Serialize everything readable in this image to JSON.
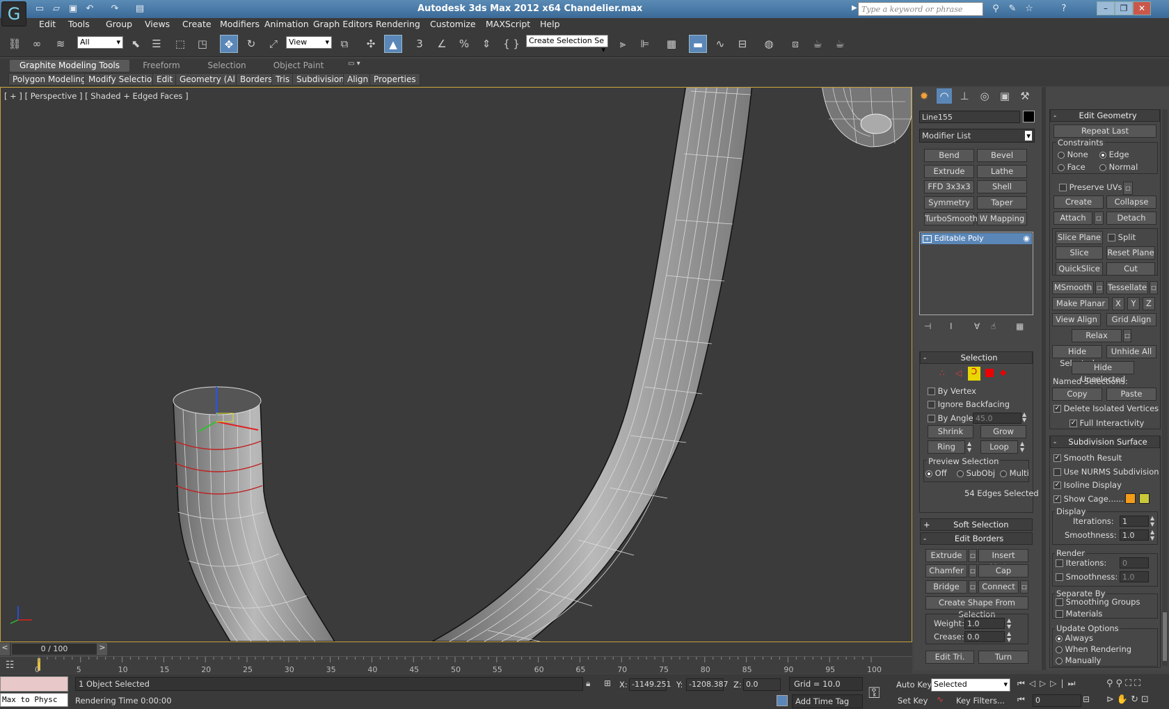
{
  "window": {
    "title": "Autodesk 3ds Max  2012 x64      Chandelier.max",
    "search_placeholder": "Type a keyword or phrase"
  },
  "menu": [
    "Edit",
    "Tools",
    "Group",
    "Views",
    "Create",
    "Modifiers",
    "Animation",
    "Graph Editors",
    "Rendering",
    "Customize",
    "MAXScript",
    "Help"
  ],
  "toolbar": {
    "filter": "All",
    "ref_coord": "View",
    "selection_set": "Create Selection Se"
  },
  "ribbon": {
    "tabs": [
      "Graphite Modeling Tools",
      "Freeform",
      "Selection",
      "Object Paint"
    ],
    "subtabs": [
      "Polygon Modeling",
      "Modify Selection",
      "Edit",
      "Geometry (All)",
      "Borders",
      "Tris",
      "Subdivision",
      "Align",
      "Properties"
    ]
  },
  "viewport": {
    "label": "[ + ] [ Perspective ] [ Shaded + Edged Faces ]"
  },
  "panel": {
    "object_name": "Line155",
    "modifier_list": "Modifier List",
    "modifier_buttons": [
      "Bend",
      "Bevel",
      "Extrude",
      "Lathe",
      "FFD 3x3x3",
      "Shell",
      "Symmetry",
      "Taper",
      "TurboSmooth",
      "W Mapping Cle"
    ],
    "stack_item": "Editable Poly",
    "selection": {
      "title": "Selection",
      "by_vertex": "By Vertex",
      "ignore_backfacing": "Ignore Backfacing",
      "by_angle": "By Angle:",
      "angle": "45.0",
      "shrink": "Shrink",
      "grow": "Grow",
      "ring": "Ring",
      "loop": "Loop",
      "preview": "Preview Selection",
      "off": "Off",
      "subobj": "SubObj",
      "multi": "Multi",
      "status": "54 Edges Selected"
    },
    "soft_selection": "Soft Selection",
    "edit_borders": {
      "title": "Edit Borders",
      "extrude": "Extrude",
      "insert_vertex": "Insert Vertex",
      "chamfer": "Chamfer",
      "cap": "Cap",
      "bridge": "Bridge",
      "connect": "Connect",
      "create_shape": "Create Shape From Selection",
      "weight_label": "Weight:",
      "weight": "1.0",
      "crease_label": "Crease:",
      "crease": "0.0",
      "edit_tri": "Edit Tri.",
      "turn": "Turn"
    },
    "edit_geometry": {
      "title": "Edit Geometry",
      "repeat_last": "Repeat Last",
      "constraints": "Constraints",
      "none": "None",
      "edge": "Edge",
      "face": "Face",
      "normal": "Normal",
      "preserve_uvs": "Preserve UVs",
      "create": "Create",
      "collapse": "Collapse",
      "attach": "Attach",
      "detach": "Detach",
      "slice_plane": "Slice Plane",
      "split": "Split",
      "slice": "Slice",
      "reset_plane": "Reset Plane",
      "quickslice": "QuickSlice",
      "cut": "Cut",
      "msmooth": "MSmooth",
      "tessellate": "Tessellate",
      "make_planar": "Make Planar",
      "x": "X",
      "y": "Y",
      "z": "Z",
      "view_align": "View Align",
      "grid_align": "Grid Align",
      "relax": "Relax",
      "hide_selected": "Hide Selected",
      "unhide_all": "Unhide All",
      "hide_unselected": "Hide Unselected",
      "named_selections": "Named Selections:",
      "copy": "Copy",
      "paste": "Paste",
      "delete_isolated": "Delete Isolated Vertices",
      "full_interactivity": "Full Interactivity"
    },
    "subdivision": {
      "title": "Subdivision Surface",
      "smooth_result": "Smooth Result",
      "use_nurms": "Use NURMS Subdivision",
      "isoline": "Isoline Display",
      "show_cage": "Show Cage......",
      "display": "Display",
      "iterations_label": "Iterations:",
      "iterations": "1",
      "smoothness_label": "Smoothness:",
      "smoothness": "1.0",
      "render": "Render",
      "r_iterations": "0",
      "r_smoothness": "1.0",
      "separate_by": "Separate By",
      "smoothing_groups": "Smoothing Groups",
      "materials": "Materials",
      "update_options": "Update Options",
      "always": "Always",
      "when_rendering": "When Rendering",
      "manually": "Manually",
      "cage_color1": "#f39c1a",
      "cage_color2": "#c8c83a"
    }
  },
  "timeline": {
    "position": "0 / 100",
    "ticks": [
      "0",
      "5",
      "10",
      "15",
      "20",
      "25",
      "30",
      "35",
      "40",
      "45",
      "50",
      "55",
      "60",
      "65",
      "70",
      "75",
      "80",
      "85",
      "90",
      "95",
      "100"
    ]
  },
  "status": {
    "selected": "1 Object Selected",
    "rendering_time": "Rendering Time  0:00:00",
    "x_label": "X:",
    "x": "-1149.251",
    "y_label": "Y:",
    "y": "-1208.387",
    "z_label": "Z:",
    "z": "0.0",
    "grid": "Grid = 10.0",
    "auto_key": "Auto Key",
    "set_key": "Set Key",
    "key_mode": "Selected",
    "key_filters": "Key Filters...",
    "add_time_tag": "Add Time Tag",
    "frame": "0",
    "script_listener": "Max to Physc"
  }
}
